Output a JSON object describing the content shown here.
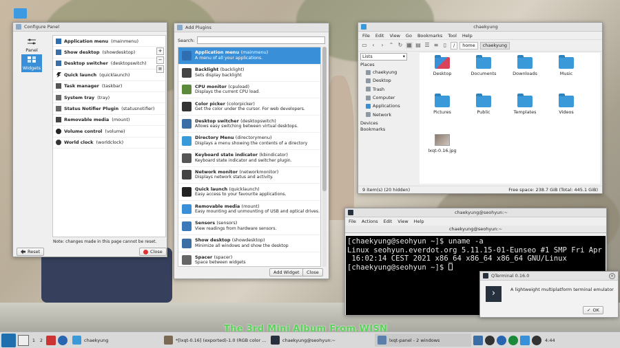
{
  "configure_panel": {
    "title": "Configure Panel",
    "sidebar": [
      {
        "label": "Panel"
      },
      {
        "label": "Widgets"
      }
    ],
    "widgets": [
      {
        "name": "Application menu",
        "id": "(mainmenu)"
      },
      {
        "name": "Show desktop",
        "id": "(showdesktop)"
      },
      {
        "name": "Desktop switcher",
        "id": "(desktopswitch)"
      },
      {
        "name": "Quick launch",
        "id": "(quicklaunch)"
      },
      {
        "name": "Task manager",
        "id": "(taskbar)"
      },
      {
        "name": "System tray",
        "id": "(tray)"
      },
      {
        "name": "Status Notifier Plugin",
        "id": "(statusnotifier)"
      },
      {
        "name": "Removable media",
        "id": "(mount)"
      },
      {
        "name": "Volume control",
        "id": "(volume)"
      },
      {
        "name": "World clock",
        "id": "(worldclock)"
      }
    ],
    "tools": [
      "+",
      "−",
      "≡"
    ],
    "note": "Note: changes made in this page cannot be reset.",
    "reset_label": "Reset",
    "close_label": "Close"
  },
  "add_plugins": {
    "title": "Add Plugins",
    "search_label": "Search:",
    "search_value": "",
    "plugins": [
      {
        "name": "Application menu",
        "id": "(mainmenu)",
        "desc": "A menu of all your applications.",
        "color": "#2f6fb1"
      },
      {
        "name": "Backlight",
        "id": "(backlight)",
        "desc": "Sets display backlight",
        "color": "#444444"
      },
      {
        "name": "CPU monitor",
        "id": "(cpuload)",
        "desc": "Displays the current CPU load.",
        "color": "#5a8a3a"
      },
      {
        "name": "Color picker",
        "id": "(colorpicker)",
        "desc": "Get the color under the cursor. For web developers.",
        "color": "#333333"
      },
      {
        "name": "Desktop switcher",
        "id": "(desktopswitch)",
        "desc": "Allows easy switching between virtual desktops.",
        "color": "#3b6ea5"
      },
      {
        "name": "Directory Menu",
        "id": "(directorymenu)",
        "desc": "Displays a menu showing the contents of a directory",
        "color": "#3a9ad9"
      },
      {
        "name": "Keyboard state indicator",
        "id": "(kbindicator)",
        "desc": "Keyboard state indicator and switcher plugin.",
        "color": "#555555"
      },
      {
        "name": "Network monitor",
        "id": "(networkmonitor)",
        "desc": "Displays network status and activity.",
        "color": "#444444"
      },
      {
        "name": "Quick launch",
        "id": "(quicklaunch)",
        "desc": "Easy access to your favourite applications.",
        "color": "#222222"
      },
      {
        "name": "Removable media",
        "id": "(mount)",
        "desc": "Easy mounting and unmounting of USB and optical drives.",
        "color": "#3a8fd9"
      },
      {
        "name": "Sensors",
        "id": "(sensors)",
        "desc": "View readings from hardware sensors.",
        "color": "#3a7ab8"
      },
      {
        "name": "Show desktop",
        "id": "(showdesktop)",
        "desc": "Minimize all windows and show the desktop",
        "color": "#3b6ea5"
      },
      {
        "name": "Spacer",
        "id": "(spacer)",
        "desc": "Space between widgets",
        "color": "#666666"
      }
    ],
    "add_widget_label": "Add Widget",
    "close_label": "Close"
  },
  "file_manager": {
    "title": "chaekyung",
    "menu": [
      "File",
      "Edit",
      "View",
      "Go",
      "Bookmarks",
      "Tool",
      "Help"
    ],
    "path": [
      "/",
      "home",
      "chaekyung"
    ],
    "view_mode": "Lists",
    "places_header": "Places",
    "places": [
      "chaekyung",
      "Desktop",
      "Trash",
      "Computer",
      "Applications",
      "Network"
    ],
    "devices_header": "Devices",
    "bookmarks_header": "Bookmarks",
    "items": [
      {
        "name": "Desktop",
        "type": "desktop"
      },
      {
        "name": "Documents",
        "type": "folder"
      },
      {
        "name": "Downloads",
        "type": "folder"
      },
      {
        "name": "Music",
        "type": "folder"
      },
      {
        "name": "Pictures",
        "type": "folder"
      },
      {
        "name": "Public",
        "type": "folder"
      },
      {
        "name": "Templates",
        "type": "folder"
      },
      {
        "name": "Videos",
        "type": "folder"
      },
      {
        "name": "lxqt-0.16.jpg",
        "type": "image"
      }
    ],
    "status_left": "9 item(s) (20 hidden)",
    "status_right": "Free space: 238.7 GiB (Total: 445.1 GiB)"
  },
  "terminal": {
    "title": "chaekyung@seohyun:~",
    "menu": [
      "File",
      "Actions",
      "Edit",
      "View",
      "Help"
    ],
    "tab": "chaekyung@seohyun:~",
    "lines": [
      "[chaekyung@seohyun ~]$ uname -a",
      "Linux seohyun.everdot.org 5.11.15-01-Eunseo #1 SMP Fri Apr 16",
      " 16:02:14 CEST 2021 x86_64 x86_64 x86_64 GNU/Linux",
      "[chaekyung@seohyun ~]$ "
    ]
  },
  "about_dialog": {
    "title": "QTerminal 0.16.0",
    "text": "A lightweight multiplatform terminal emulator",
    "ok_label": "OK"
  },
  "taskbar": {
    "desktops": [
      "1",
      "2"
    ],
    "tasks": [
      {
        "label": "chaekyung",
        "color": "#3a9ad9"
      },
      {
        "label": "*[lxqt-0.16] (exported)-1.0 (RGB color ...",
        "color": "#7a6a55"
      },
      {
        "label": "chaekyung@seohyun:~",
        "color": "#26313d"
      },
      {
        "label": "lxqt-panel - 2 windows",
        "color": "#5a7fa8"
      }
    ],
    "clock": "4:44"
  },
  "wallpaper": {
    "title": "The  3rd  Mini  Album  From.WJSN"
  },
  "colors": {
    "accent": "#3a8fd9",
    "taskbar": "#d9d9d9",
    "terminal_bg": "#000000"
  }
}
